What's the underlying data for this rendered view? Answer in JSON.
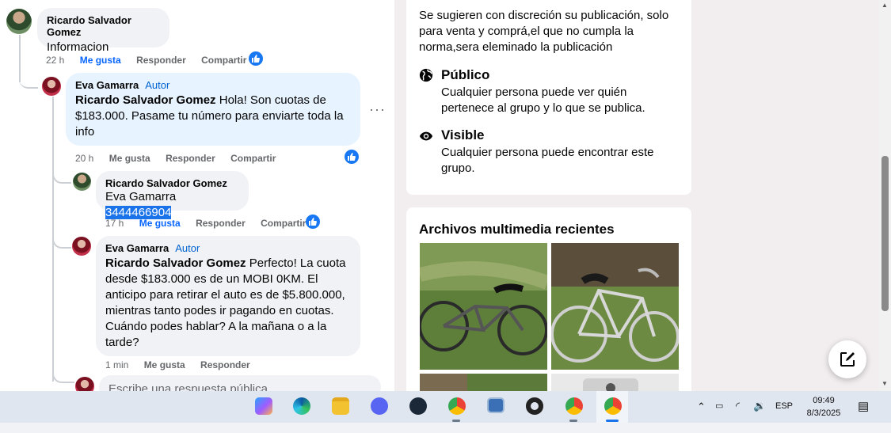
{
  "comments": [
    {
      "author": "Ricardo Salvador Gomez",
      "badge": "",
      "text_plain": "Informacion",
      "meta": {
        "time": "22 h",
        "like": "Me gusta",
        "reply": "Responder",
        "share": "Compartir"
      }
    },
    {
      "author": "Eva Gamarra",
      "badge": "Autor",
      "mention": "Ricardo Salvador Gomez",
      "text_plain": " Hola! Son cuotas de $183.000. Pasame tu número para enviarte toda la info",
      "meta": {
        "time": "20 h",
        "like": "Me gusta",
        "reply": "Responder",
        "share": "Compartir"
      }
    },
    {
      "author": "Ricardo Salvador Gomez",
      "badge": "",
      "mention": "Eva Gamarra",
      "text_plain": " ",
      "highlighted": "3444466904",
      "meta": {
        "time": "17 h",
        "like": "Me gusta",
        "reply": "Responder",
        "share": "Compartir"
      }
    },
    {
      "author": "Eva Gamarra",
      "badge": "Autor",
      "mention": "Ricardo Salvador Gomez",
      "text_plain": " Perfecto! La cuota desde $183.000 es de un MOBI 0KM. El anticipo para retirar el auto es de $5.800.000, mientras tanto podes ir pagando en cuotas. Cuándo podes hablar? A la mañana o a la tarde?",
      "meta": {
        "time": "1 min",
        "like": "Me gusta",
        "reply": "Responder"
      }
    }
  ],
  "reply_placeholder": "Escribe una respuesta pública...",
  "about": {
    "description": "Se sugieren con discreción su publicación, solo para venta y comprá,el que no cumpla la norma,sera eleminado la publicación",
    "public_title": "Público",
    "public_desc": "Cualquier persona puede ver quién pertenece al grupo y lo que se publica.",
    "visible_title": "Visible",
    "visible_desc": "Cualquier persona puede encontrar este grupo."
  },
  "media": {
    "title": "Archivos multimedia recientes"
  },
  "taskbar": {
    "lang": "ESP",
    "time": "09:49",
    "date": "8/3/2025",
    "apps": [
      "copilot-icon",
      "edge-icon",
      "file-explorer-icon",
      "discord-icon",
      "steam-icon",
      "chrome-icon",
      "remote-desktop-icon",
      "settings-icon",
      "chrome-profile-c-icon",
      "chrome-profile-icon"
    ]
  },
  "colors": {
    "accent": "#0866ff",
    "author_bubble": "#e7f3ff",
    "bubble": "#f0f2f5"
  }
}
